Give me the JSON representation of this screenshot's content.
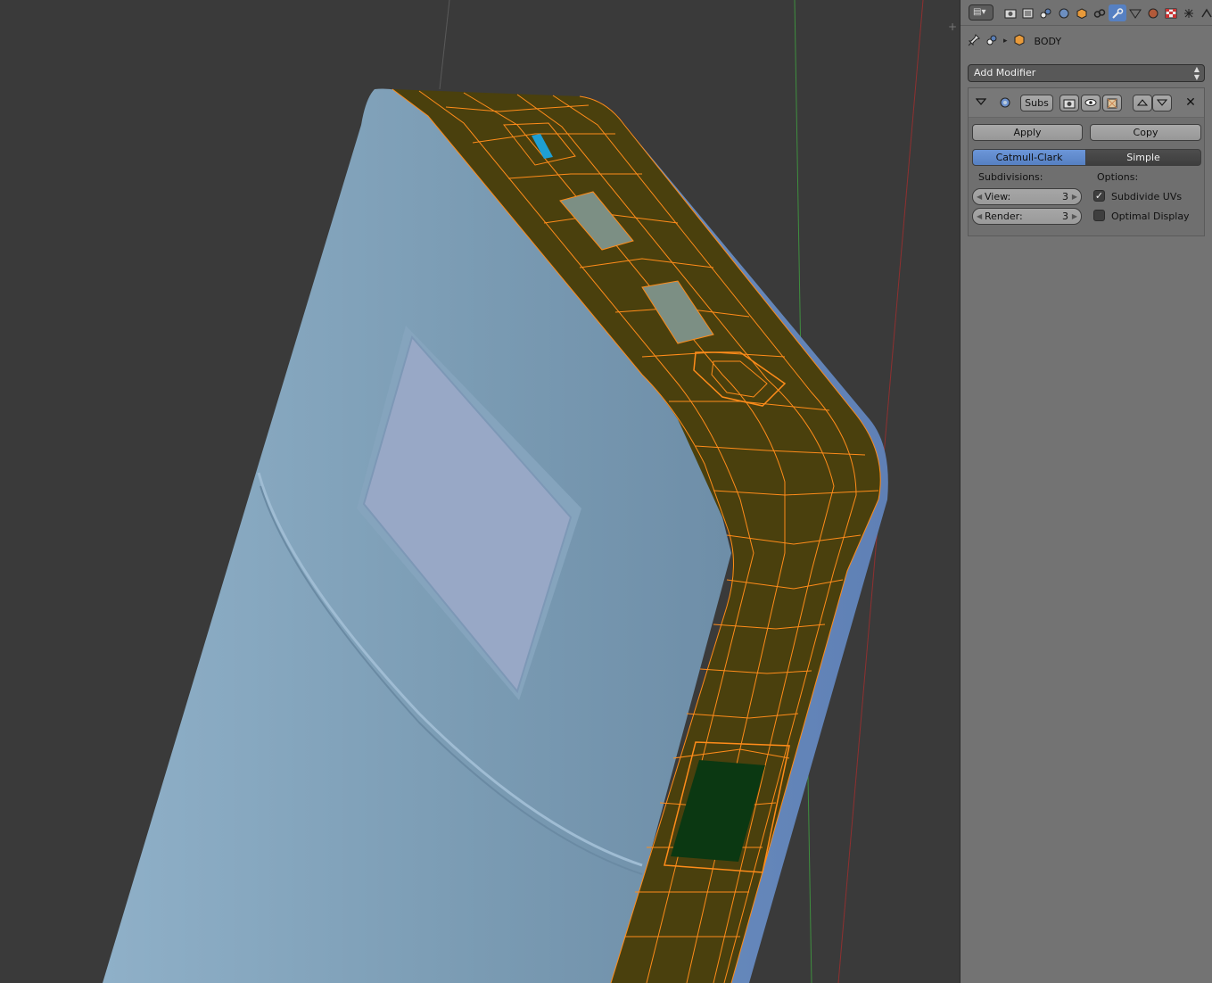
{
  "properties": {
    "object_name": "BODY",
    "add_modifier_label": "Add Modifier",
    "modifier": {
      "name": "Subs",
      "apply_label": "Apply",
      "copy_label": "Copy",
      "algorithm_options": [
        "Catmull-Clark",
        "Simple"
      ],
      "selected_algorithm": "Catmull-Clark",
      "subdivisions_label": "Subdivisions:",
      "options_label": "Options:",
      "view_label": "View:",
      "view_value": "3",
      "render_label": "Render:",
      "render_value": "3",
      "subdivide_uvs_label": "Subdivide UVs",
      "subdivide_uvs_checked": true,
      "optimal_display_label": "Optimal Display",
      "optimal_display_checked": false
    },
    "context_tabs": [
      "render-icon",
      "render-layers-icon",
      "scene-icon",
      "world-icon",
      "object-icon",
      "constraints-icon",
      "modifiers-icon",
      "data-icon",
      "material-icon",
      "texture-icon",
      "particles-icon",
      "physics-icon"
    ],
    "active_tab": "modifiers-icon"
  },
  "colors": {
    "viewport_bg": "#3a3a3a",
    "mesh_body": "#7b9cb5",
    "selected_face": "#4a3f0e",
    "wire_selected": "#ff8c1a",
    "panel_bg": "#737373",
    "accent": "#5680c2"
  }
}
